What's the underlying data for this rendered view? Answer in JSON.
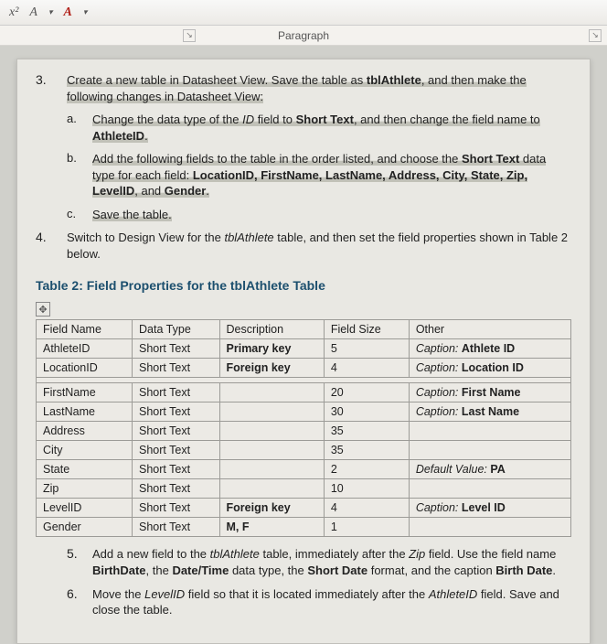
{
  "ribbon": {
    "superscript": "x²",
    "btn_a1": "A",
    "btn_a_red": "A",
    "group_label": "Paragraph"
  },
  "q3": {
    "num": "3.",
    "text_a": "Create a new table in Datasheet View. Save the table as ",
    "tbl": "tblAthlete",
    "text_b": ", and then make the following changes in Datasheet View:",
    "a": {
      "letter": "a.",
      "t1": "Change the data type of the ",
      "id": "ID",
      "t2": " field to ",
      "st": "Short Text",
      "t3": ", and then change the field name to ",
      "aid": "AthleteID",
      "t4": "."
    },
    "b": {
      "letter": "b.",
      "t1": "Add the following fields to the table in the order listed, and choose the ",
      "st": "Short Text",
      "t2": " data type for each field: ",
      "fields": "LocationID, FirstName, LastName, Address, City, State, Zip, LevelID",
      "t3": ", and ",
      "gender": "Gender",
      "t4": "."
    },
    "c": {
      "letter": "c.",
      "text": "Save the table."
    }
  },
  "q4": {
    "num": "4.",
    "t1": "Switch to Design View for the ",
    "tbl": "tblAthlete",
    "t2": " table, and then set the field properties shown in Table 2 below."
  },
  "table2": {
    "title": "Table 2: Field Properties for the tblAthlete Table",
    "headers": {
      "c1": "Field Name",
      "c2": "Data Type",
      "c3": "Description",
      "c4": "Field Size",
      "c5": "Other"
    },
    "rows": [
      {
        "name": "AthleteID",
        "type": "Short Text",
        "desc": "Primary key",
        "size": "5",
        "other": "Caption: Athlete ID"
      },
      {
        "name": "LocationID",
        "type": "Short Text",
        "desc": "Foreign key",
        "size": "4",
        "other": "Caption: Location ID"
      },
      {
        "name": "FirstName",
        "type": "Short Text",
        "desc": "",
        "size": "20",
        "other": "Caption: First Name"
      },
      {
        "name": "LastName",
        "type": "Short Text",
        "desc": "",
        "size": "30",
        "other": "Caption: Last Name"
      },
      {
        "name": "Address",
        "type": "Short Text",
        "desc": "",
        "size": "35",
        "other": ""
      },
      {
        "name": "City",
        "type": "Short Text",
        "desc": "",
        "size": "35",
        "other": ""
      },
      {
        "name": "State",
        "type": "Short Text",
        "desc": "",
        "size": "2",
        "other": "Default Value: PA"
      },
      {
        "name": "Zip",
        "type": "Short Text",
        "desc": "",
        "size": "10",
        "other": ""
      },
      {
        "name": "LevelID",
        "type": "Short Text",
        "desc": "Foreign key",
        "size": "4",
        "other": "Caption: Level ID"
      },
      {
        "name": "Gender",
        "type": "Short Text",
        "desc": "M, F",
        "size": "1",
        "other": ""
      }
    ]
  },
  "q5": {
    "num": "5.",
    "t1": "Add a new field to the ",
    "tbl": "tblAthlete",
    "t2": " table, immediately after the ",
    "zip": "Zip",
    "t3": " field. Use the field name ",
    "bd": "BirthDate",
    "t4": ", the ",
    "dt": "Date/Time",
    "t5": " data type, the ",
    "sd": "Short Date",
    "t6": " format, and the caption ",
    "cap": "Birth Date",
    "t7": "."
  },
  "q6": {
    "num": "6.",
    "t1": "Move the ",
    "lvl": "LevelID",
    "t2": " field so that it is located immediately after the ",
    "aid": "AthleteID",
    "t3": " field. Save and close the table."
  }
}
